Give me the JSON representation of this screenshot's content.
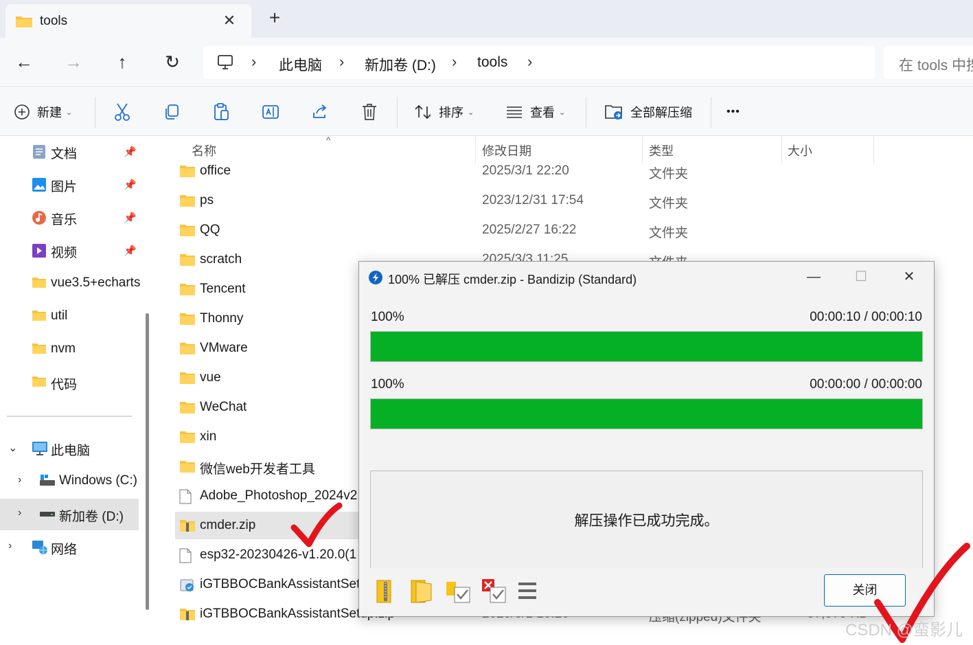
{
  "tab": {
    "title": "tools",
    "close_glyph": "✕",
    "add_glyph": "+"
  },
  "nav": {
    "back_glyph": "←",
    "forward_glyph": "→",
    "up_glyph": "↑",
    "refresh_glyph": "↻",
    "breadcrumbs": [
      "此电脑",
      "新加卷 (D:)",
      "tools"
    ],
    "search_placeholder": "在 tools 中搜"
  },
  "toolbar": {
    "new_label": "新建",
    "sort_label": "排序",
    "view_label": "查看",
    "extract_all_label": "全部解压缩",
    "more_glyph": "•••",
    "icons": [
      "cut-icon",
      "copy-icon",
      "paste-icon",
      "rename-icon",
      "share-icon",
      "delete-icon"
    ]
  },
  "sidebar": {
    "quick": [
      {
        "label": "文档",
        "icon": "documents-icon",
        "pinned": true
      },
      {
        "label": "图片",
        "icon": "pictures-icon",
        "pinned": true
      },
      {
        "label": "音乐",
        "icon": "music-icon",
        "pinned": true
      },
      {
        "label": "视频",
        "icon": "videos-icon",
        "pinned": true
      },
      {
        "label": "vue3.5+echarts",
        "icon": "folder-icon"
      },
      {
        "label": "util",
        "icon": "folder-icon"
      },
      {
        "label": "nvm",
        "icon": "folder-icon"
      },
      {
        "label": "代码",
        "icon": "folder-icon"
      }
    ],
    "this_pc": "此电脑",
    "drive_c": "Windows  (C:)",
    "drive_d": "新加卷 (D:)",
    "network": "网络"
  },
  "filelist": {
    "columns": {
      "name": "名称",
      "modified": "修改日期",
      "type": "类型",
      "size": "大小"
    },
    "rows": [
      {
        "name": "office",
        "date": "2025/3/1 22:20",
        "type": "文件夹",
        "size": "",
        "kind": "folder"
      },
      {
        "name": "ps",
        "date": "2023/12/31 17:54",
        "type": "文件夹",
        "size": "",
        "kind": "folder"
      },
      {
        "name": "QQ",
        "date": "2025/2/27 16:22",
        "type": "文件夹",
        "size": "",
        "kind": "folder"
      },
      {
        "name": "scratch",
        "date": "2025/3/3 11:25",
        "type": "文件夹",
        "size": "",
        "kind": "folder"
      },
      {
        "name": "Tencent",
        "date": "",
        "type": "",
        "size": "",
        "kind": "folder"
      },
      {
        "name": "Thonny",
        "date": "",
        "type": "",
        "size": "",
        "kind": "folder"
      },
      {
        "name": "VMware",
        "date": "",
        "type": "",
        "size": "",
        "kind": "folder"
      },
      {
        "name": "vue",
        "date": "",
        "type": "",
        "size": "",
        "kind": "folder"
      },
      {
        "name": "WeChat",
        "date": "",
        "type": "",
        "size": "",
        "kind": "folder"
      },
      {
        "name": "xin",
        "date": "",
        "type": "",
        "size": "",
        "kind": "folder"
      },
      {
        "name": "微信web开发者工具",
        "date": "",
        "type": "",
        "size": "",
        "kind": "folder"
      },
      {
        "name": "Adobe_Photoshop_2024v2",
        "date": "",
        "type": "",
        "size": "",
        "kind": "file"
      },
      {
        "name": "cmder.zip",
        "date": "",
        "type": "",
        "size": "",
        "kind": "zip",
        "selected": true
      },
      {
        "name": "esp32-20230426-v1.20.0(1",
        "date": "",
        "type": "",
        "size": "",
        "kind": "file"
      },
      {
        "name": "iGTBBOCBankAssistantSetu",
        "date": "",
        "type": "",
        "size": "",
        "kind": "installer"
      },
      {
        "name": "iGTBBOCBankAssistantSetup.zip",
        "date": "2025/3/1 10:26",
        "type": "压缩(zipped)文件夹",
        "size": "37,379 KB",
        "kind": "zip"
      }
    ]
  },
  "dialog": {
    "title": "100% 已解压 cmder.zip - Bandizip (Standard)",
    "minimize_glyph": "—",
    "maximize_glyph": "☐",
    "close_glyph": "✕",
    "progress1": {
      "percent_text": "100%",
      "time": "00:00:10 / 00:00:10",
      "fill": 1.0
    },
    "progress2": {
      "percent_text": "100%",
      "time": "00:00:00 / 00:00:00",
      "fill": 1.0
    },
    "message": "解压操作已成功完成。",
    "close_button": "关闭",
    "tool_icons": [
      "open-archive-icon",
      "open-folder-icon",
      "check-files-icon",
      "delete-archive-icon",
      "menu-icon"
    ]
  },
  "watermark": "CSDN @蛮影儿",
  "colors": {
    "progress": "#06b025",
    "accent": "#0067c0",
    "annotation": "#e3141b",
    "folder": "#f4c542"
  }
}
